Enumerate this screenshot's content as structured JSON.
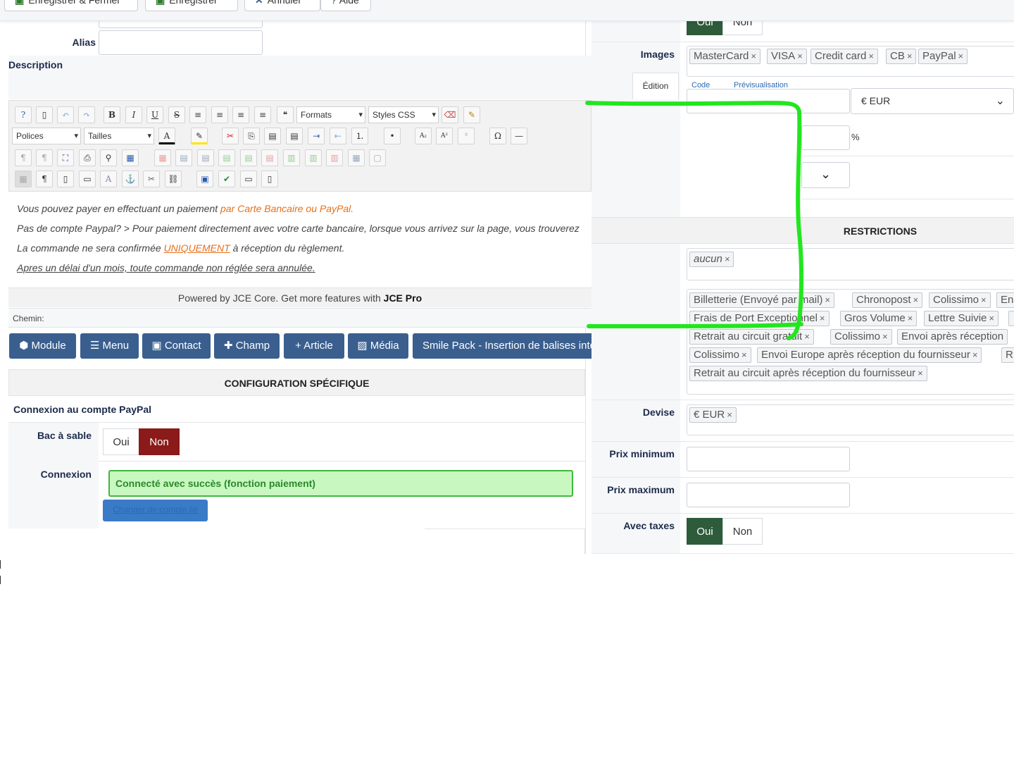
{
  "toolbar": {
    "save_close": "Enregistrer & Fermer",
    "save": "Enregistrer",
    "cancel": "Annuler",
    "help": "Aide"
  },
  "left": {
    "alias_label": "Alias",
    "description_label": "Description",
    "editor": {
      "formats": "Formats",
      "styles": "Styles CSS",
      "fonts": "Polices",
      "sizes": "Tailles"
    },
    "content": {
      "line1_a": "Vous pouvez payer en effectuant un paiement ",
      "line1_b": "par Carte Bancaire ou PayPal.",
      "line2": "Pas de compte Paypal? > Pour paiement directement avec votre carte bancaire, lorsque vous arrivez sur la page, vous trouverez",
      "line3_a": "La commande ne sera confirmée ",
      "line3_b": "UNIQUEMENT",
      "line3_c": " à réception du règlement.",
      "line4": "Apres un délai d'un mois, toute commande non réglée sera annulée."
    },
    "powered_a": "Powered by JCE Core. Get more features with ",
    "powered_b": "JCE Pro",
    "path_label": "Chemin:",
    "plugins": [
      "Module",
      "Menu",
      "Contact",
      "Champ",
      "+ Article",
      "Média",
      "Smile Pack - Insertion de balises intel"
    ],
    "section_title": "CONFIGURATION SPÉCIFIQUE",
    "paypal_title": "Connexion au compte PayPal",
    "sandbox_label": "Bac à sable",
    "sandbox_yes": "Oui",
    "sandbox_no": "Non",
    "connexion_label": "Connexion",
    "connected_msg": "Connecté avec succès (fonction paiement)",
    "change_account": "Changer de compte lié"
  },
  "right": {
    "top_yes": "Oui",
    "top_no": "Non",
    "images_label": "Images",
    "image_tags": [
      "MasterCard",
      "VISA",
      "Credit card",
      "CB",
      "PayPal"
    ],
    "edition_tab": "Édition",
    "code_tab": "Code",
    "preview_tab": "Prévisualisation",
    "currency_select": "€ EUR",
    "percent": "%",
    "restrictions_title": "RESTRICTIONS",
    "restriction_tag": "aucun",
    "shipping_tags_row1": [
      "Billetterie (Envoyé par mail)",
      "Chronopost",
      "Colissimo",
      "En"
    ],
    "shipping_tags_row2": [
      "Frais de Port Exceptionnel",
      "Gros Volume",
      "Lettre Suivie",
      ""
    ],
    "shipping_tags_row3": [
      "Retrait au circuit gratuit",
      "Colissimo",
      "Envoi après réception"
    ],
    "shipping_tags_row4": [
      "Colissimo",
      "Envoi Europe après réception du fournisseur",
      "R"
    ],
    "shipping_tags_row5": [
      "Retrait au circuit après réception du fournisseur"
    ],
    "devise_label": "Devise",
    "devise_tag": "€ EUR",
    "min_price_label": "Prix minimum",
    "max_price_label": "Prix maximum",
    "taxes_label": "Avec taxes",
    "taxes_yes": "Oui",
    "taxes_no": "Non"
  },
  "colors": {
    "primary_blue": "#3a5f8f",
    "dark_green": "#2e5b3a",
    "dark_red": "#8b1a1a",
    "success_bg": "#c8f7c0",
    "success_border": "#3eb93e",
    "annotation_green": "#22e61f"
  }
}
